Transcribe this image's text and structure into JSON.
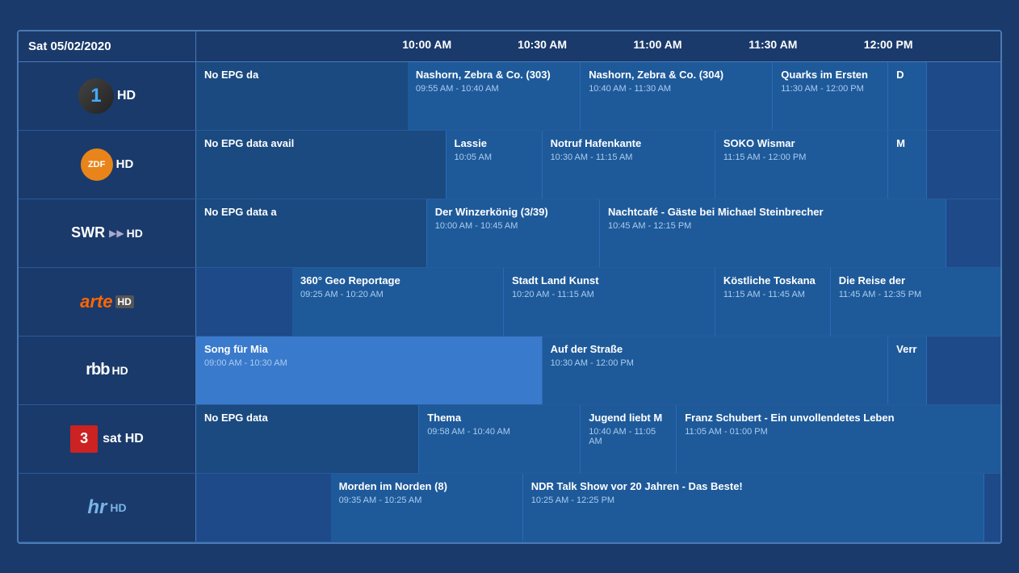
{
  "header": {
    "date": "Sat 05/02/2020",
    "times": [
      {
        "label": "10:00 AM",
        "pct": 0
      },
      {
        "label": "10:30 AM",
        "pct": 25
      },
      {
        "label": "11:00 AM",
        "pct": 50
      },
      {
        "label": "11:30 AM",
        "pct": 75
      },
      {
        "label": "12:00 PM",
        "pct": 100
      }
    ]
  },
  "timeRange": {
    "start": 540,
    "end": 720,
    "viewStart": 600,
    "viewEnd": 720
  },
  "channels": [
    {
      "id": "das-erste-hd",
      "name": "Das Erste HD",
      "logoType": "das-erste",
      "programs": [
        {
          "name": "No EPG da",
          "start": 540,
          "end": 597,
          "noEpg": true
        },
        {
          "name": "Nashorn, Zebra & Co. (303)",
          "time": "09:55 AM - 10:40 AM",
          "start": 595,
          "end": 640
        },
        {
          "name": "Nashorn, Zebra & Co. (304)",
          "time": "10:40 AM - 11:30 AM",
          "start": 640,
          "end": 690
        },
        {
          "name": "Quarks im Ersten",
          "time": "11:30 AM - 12:00 PM",
          "start": 690,
          "end": 720
        },
        {
          "name": "D",
          "time": "",
          "start": 720,
          "end": 730
        }
      ]
    },
    {
      "id": "zdf-hd",
      "name": "ZDF HD",
      "logoType": "zdf",
      "programs": [
        {
          "name": "No EPG data avail",
          "start": 540,
          "end": 605,
          "noEpg": true
        },
        {
          "name": "Lassie",
          "time": "10:05 AM",
          "start": 605,
          "end": 630
        },
        {
          "name": "Notruf Hafenkante",
          "time": "10:30 AM - 11:15 AM",
          "start": 630,
          "end": 675
        },
        {
          "name": "SOKO Wismar",
          "time": "11:15 AM - 12:00 PM",
          "start": 675,
          "end": 720
        },
        {
          "name": "M",
          "time": "",
          "start": 720,
          "end": 730
        }
      ]
    },
    {
      "id": "swr-hd",
      "name": "SWR HD",
      "logoType": "swr",
      "programs": [
        {
          "name": "No EPG data a",
          "start": 540,
          "end": 600,
          "noEpg": true
        },
        {
          "name": "Der Winzerkönig (3/39)",
          "time": "10:00 AM - 10:45 AM",
          "start": 600,
          "end": 645
        },
        {
          "name": "Nachtcafé - Gäste bei Michael Steinbrecher",
          "time": "10:45 AM - 12:15 PM",
          "start": 645,
          "end": 735
        }
      ]
    },
    {
      "id": "arte-hd",
      "name": "arte HD",
      "logoType": "arte",
      "programs": [
        {
          "name": "360° Geo Reportage",
          "time": "09:25 AM - 10:20 AM",
          "start": 565,
          "end": 620
        },
        {
          "name": "Stadt Land Kunst",
          "time": "10:20 AM - 11:15 AM",
          "start": 620,
          "end": 675
        },
        {
          "name": "Köstliche Toskana",
          "time": "11:15 AM - 11:45 AM",
          "start": 675,
          "end": 705
        },
        {
          "name": "Die Reise der",
          "time": "11:45 AM - 12:35 PM",
          "start": 705,
          "end": 755
        }
      ]
    },
    {
      "id": "rbb-hd",
      "name": "rbb HD",
      "logoType": "rbb",
      "programs": [
        {
          "name": "Song für Mia",
          "time": "09:00 AM - 10:30 AM",
          "start": 540,
          "end": 630,
          "selected": true
        },
        {
          "name": "Auf der Straße",
          "time": "10:30 AM - 12:00 PM",
          "start": 630,
          "end": 720
        },
        {
          "name": "Verr",
          "time": "",
          "start": 720,
          "end": 730
        }
      ]
    },
    {
      "id": "sat3-hd",
      "name": "3sat HD",
      "logoType": "sat3",
      "programs": [
        {
          "name": "No EPG data",
          "start": 540,
          "end": 598,
          "noEpg": true
        },
        {
          "name": "Thema",
          "time": "09:58 AM - 10:40 AM",
          "start": 598,
          "end": 640
        },
        {
          "name": "Jugend liebt M",
          "time": "10:40 AM - 11:05 AM",
          "start": 640,
          "end": 665
        },
        {
          "name": "Franz Schubert - Ein unvollendetes Leben",
          "time": "11:05 AM - 01:00 PM",
          "start": 665,
          "end": 780
        }
      ]
    },
    {
      "id": "hr-hd",
      "name": "hr HD",
      "logoType": "hr",
      "programs": [
        {
          "name": "Morden im Norden (8)",
          "time": "09:35 AM - 10:25 AM",
          "start": 575,
          "end": 625
        },
        {
          "name": "NDR Talk Show vor 20 Jahren - Das Beste!",
          "time": "10:25 AM - 12:25 PM",
          "start": 625,
          "end": 745
        }
      ]
    }
  ]
}
